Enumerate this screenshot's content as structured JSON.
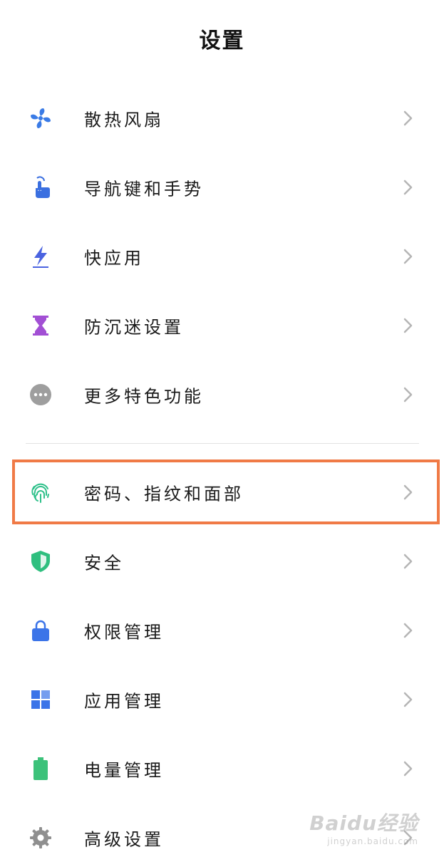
{
  "header": {
    "title": "设置"
  },
  "items_group1": [
    {
      "label": "散热风扇",
      "icon": "fan-icon"
    },
    {
      "label": "导航键和手势",
      "icon": "tap-gesture-icon"
    },
    {
      "label": "快应用",
      "icon": "lightning-icon"
    },
    {
      "label": "防沉迷设置",
      "icon": "hourglass-icon"
    },
    {
      "label": "更多特色功能",
      "icon": "more-dots-icon"
    }
  ],
  "items_group2": [
    {
      "label": "密码、指纹和面部",
      "icon": "fingerprint-icon",
      "highlighted": true
    },
    {
      "label": "安全",
      "icon": "shield-icon"
    },
    {
      "label": "权限管理",
      "icon": "lock-icon"
    },
    {
      "label": "应用管理",
      "icon": "app-grid-icon"
    },
    {
      "label": "电量管理",
      "icon": "battery-icon"
    },
    {
      "label": "高级设置",
      "icon": "gear-icon"
    }
  ],
  "colors": {
    "highlight_border": "#f07a46",
    "chevron": "#b5b5b5",
    "fan": "#3a7be6",
    "gesture": "#3a6fe0",
    "lightning": "#4a63e0",
    "hourglass": "#a24fd4",
    "more": "#9e9e9e",
    "fingerprint": "#2ec08a",
    "shield": "#2fbf7f",
    "lock": "#3b74e8",
    "app_grid": "#3b74e8",
    "battery": "#3cc27a",
    "gear": "#8f8f8f"
  },
  "watermark": {
    "main": "Baidu经验",
    "sub": "jingyan.baidu.com"
  }
}
